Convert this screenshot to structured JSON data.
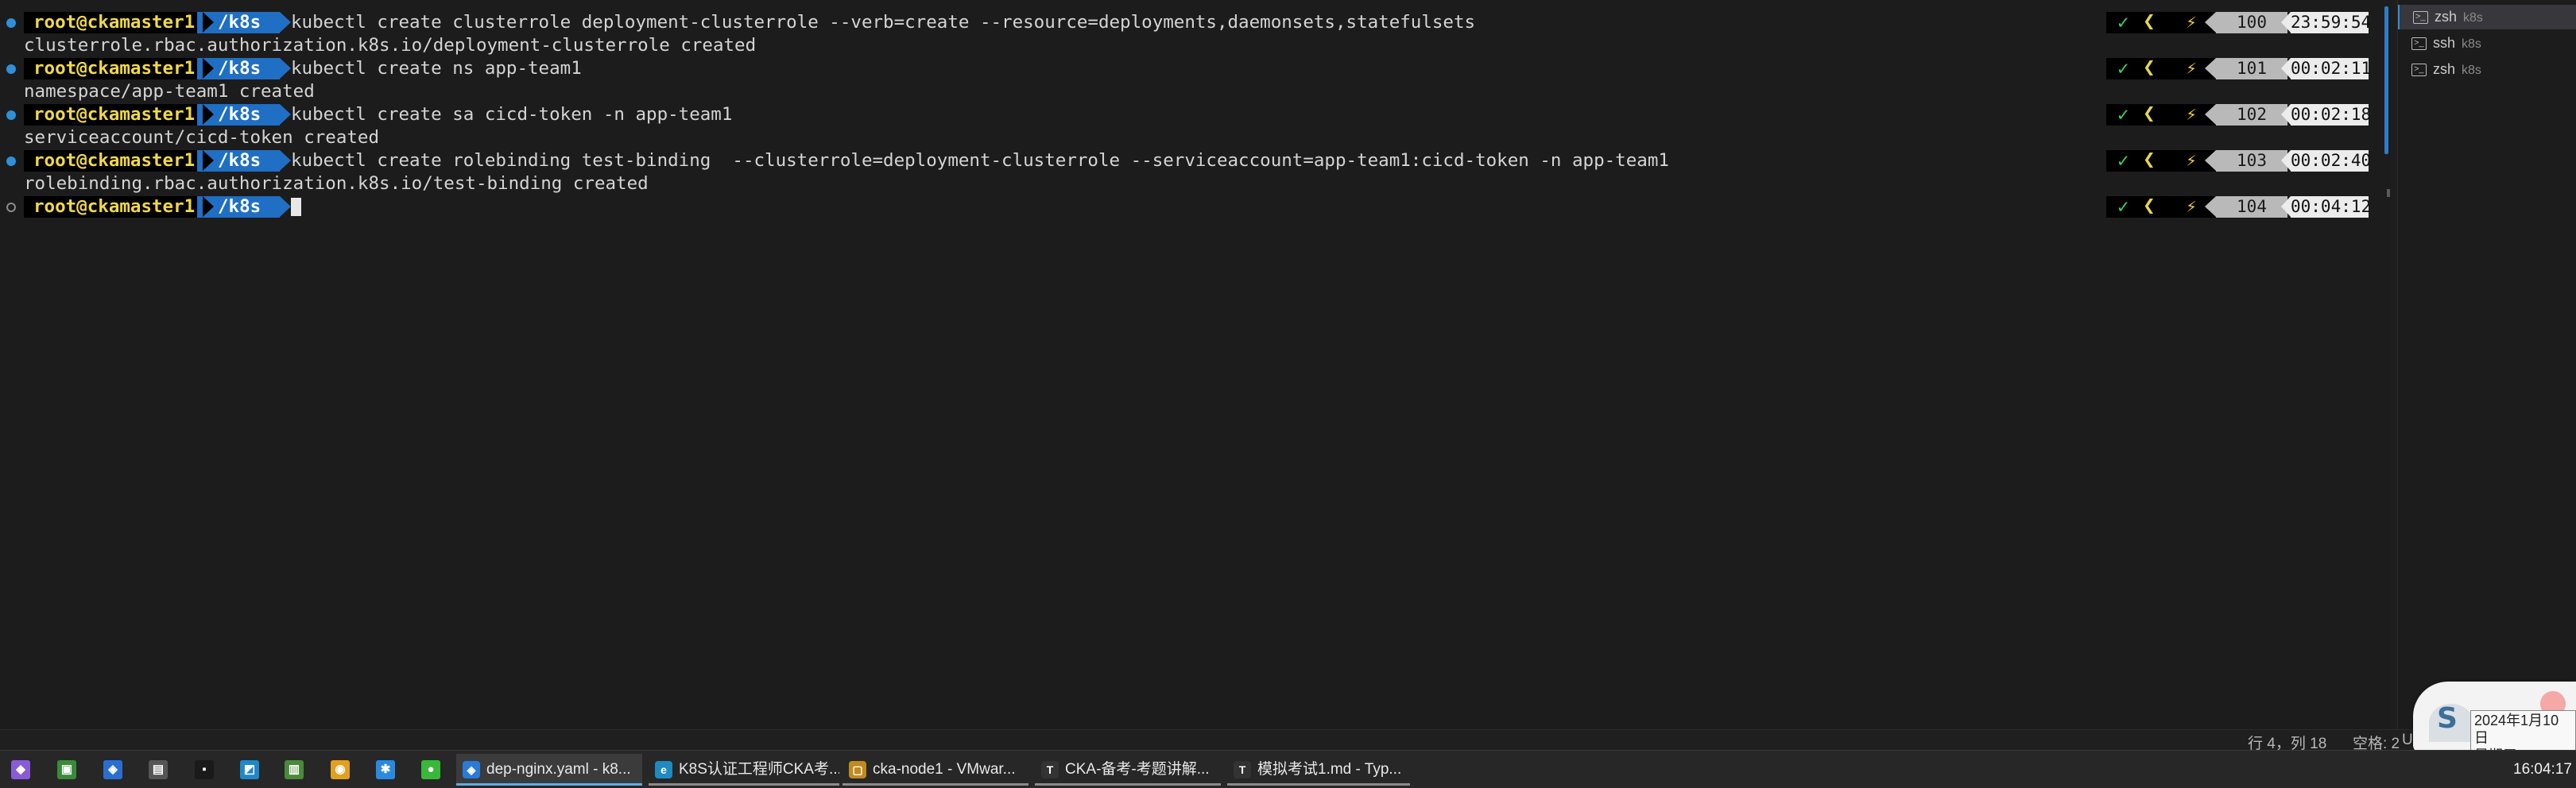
{
  "prompt": {
    "user": "root@ckamaster1",
    "dir": "/k8s"
  },
  "terminal": {
    "lines": [
      {
        "kind": "cmd",
        "text": "kubectl create clusterrole deployment-clusterrole --verb=create --resource=deployments,daemonsets,statefulsets",
        "num": "100",
        "time": "23:59:54"
      },
      {
        "kind": "out",
        "text": "clusterrole.rbac.authorization.k8s.io/deployment-clusterrole created"
      },
      {
        "kind": "cmd",
        "text": "kubectl create ns app-team1",
        "num": "101",
        "time": "00:02:11"
      },
      {
        "kind": "out",
        "text": "namespace/app-team1 created"
      },
      {
        "kind": "cmd",
        "text": "kubectl create sa cicd-token -n app-team1",
        "num": "102",
        "time": "00:02:18"
      },
      {
        "kind": "out",
        "text": "serviceaccount/cicd-token created"
      },
      {
        "kind": "cmd",
        "text": "kubectl create rolebinding test-binding  --clusterrole=deployment-clusterrole --serviceaccount=app-team1:cicd-token -n app-team1",
        "num": "103",
        "time": "00:02:40"
      },
      {
        "kind": "out",
        "text": "rolebinding.rbac.authorization.k8s.io/test-binding created"
      },
      {
        "kind": "current",
        "text": "",
        "num": "104",
        "time": "00:04:12"
      }
    ]
  },
  "right_prompt_symbols": {
    "check": "✓",
    "arrow": "❮",
    "bolt": "⚡"
  },
  "terminal_tabs": [
    {
      "name": "zsh",
      "sub": "k8s",
      "active": true,
      "icon": "terminal-icon"
    },
    {
      "name": "ssh",
      "sub": "k8s",
      "active": false,
      "icon": "terminal-icon"
    },
    {
      "name": "zsh",
      "sub": "k8s",
      "active": false,
      "icon": "terminal-icon"
    }
  ],
  "statusbar": {
    "position": "行 4，列 18",
    "spaces": "空格: 2",
    "encoding": "U"
  },
  "date_popup": {
    "date": "2024年1月10日",
    "weekday": "星期三"
  },
  "taskbar": {
    "pinned": [
      {
        "icon": "visual-studio-icon",
        "glyph": "◆",
        "color": "#8a5bd6"
      },
      {
        "icon": "app-green-icon",
        "glyph": "▣",
        "color": "#3a8a3a"
      },
      {
        "icon": "vscode-blue-icon",
        "glyph": "◈",
        "color": "#2a6fd0"
      },
      {
        "icon": "terminal-app-icon",
        "glyph": "▤",
        "color": "#555555"
      },
      {
        "icon": "jetbrains-icon",
        "glyph": "▪",
        "color": "#1a1a1a"
      },
      {
        "icon": "folder-sync-icon",
        "glyph": "◩",
        "color": "#1e88c8"
      },
      {
        "icon": "document-icon",
        "glyph": "▥",
        "color": "#4a8a3a"
      },
      {
        "icon": "chrome-icon",
        "glyph": "◉",
        "color": "#e0a020"
      },
      {
        "icon": "star-app-icon",
        "glyph": "✱",
        "color": "#2a8ae0"
      },
      {
        "icon": "wechat-icon",
        "glyph": "●",
        "color": "#38b838"
      }
    ],
    "apps": [
      {
        "label": "dep-nginx.yaml - k8...",
        "icon": "vscode-icon",
        "glyph": "◈",
        "color": "#2a7ad8",
        "active": true
      },
      {
        "label": "K8S认证工程师CKA考...",
        "icon": "edge-icon",
        "glyph": "e",
        "color": "#1f8ac0",
        "active": false
      },
      {
        "label": "cka-node1 - VMwar...",
        "icon": "vmware-icon",
        "glyph": "▢",
        "color": "#c08a20",
        "active": false
      },
      {
        "label": "CKA-备考-考题讲解...",
        "icon": "typora-icon",
        "glyph": "T",
        "color": "#333333",
        "active": false
      },
      {
        "label": "模拟考试1.md - Typ...",
        "icon": "typora-icon",
        "glyph": "T",
        "color": "#333333",
        "active": false
      }
    ],
    "clock": "16:04:17"
  }
}
